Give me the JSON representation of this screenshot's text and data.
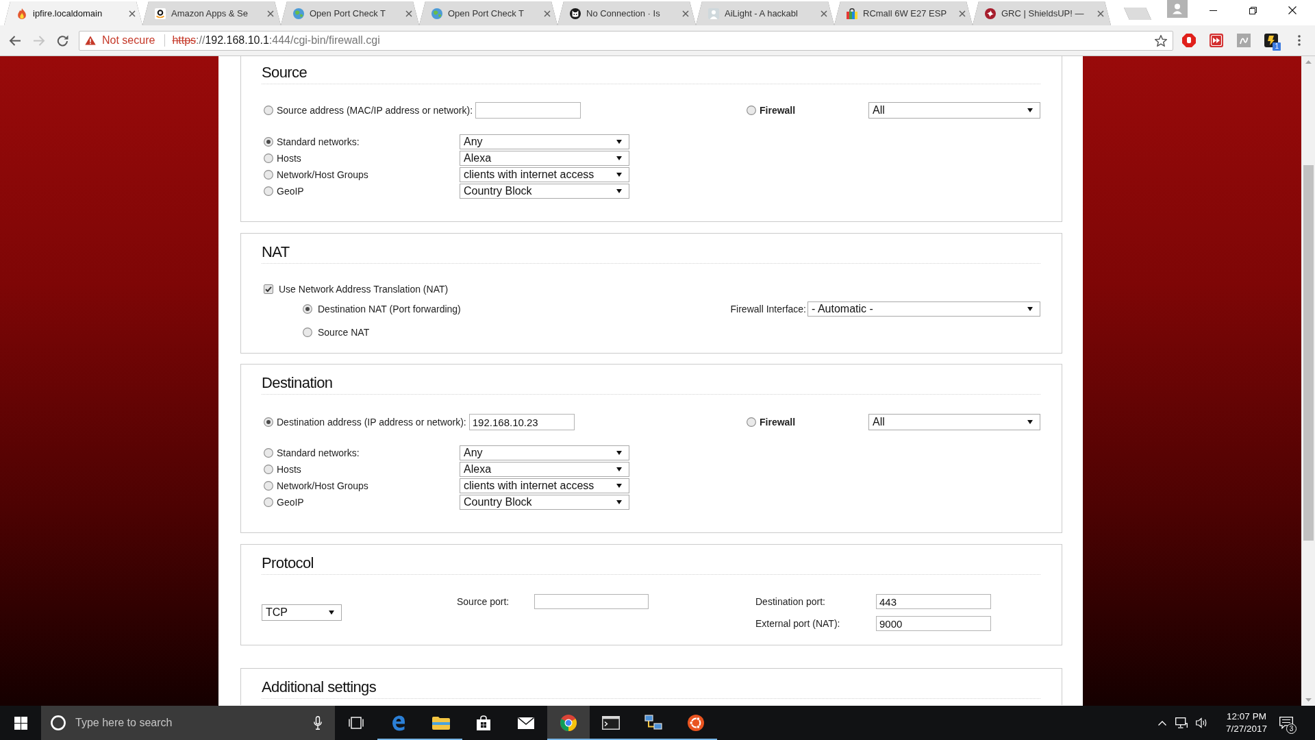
{
  "browser": {
    "tabs": [
      {
        "title": "ipfire.localdomain",
        "selected": true
      },
      {
        "title": "Amazon Apps & Se",
        "selected": false
      },
      {
        "title": "Open Port Check T",
        "selected": false
      },
      {
        "title": "Open Port Check T",
        "selected": false
      },
      {
        "title": "No Connection · Is",
        "selected": false
      },
      {
        "title": "AiLight - A hackabl",
        "selected": false
      },
      {
        "title": "RCmall 6W E27 ESP",
        "selected": false
      },
      {
        "title": "GRC | ShieldsUP! —",
        "selected": false
      }
    ],
    "forward_button": {
      "disabled": true
    },
    "address_bar": {
      "security_label": "Not secure",
      "url": {
        "scheme": "https",
        "separator": "://",
        "host": "192.168.10.1",
        "path": ":444/cgi-bin/firewall.cgi"
      }
    },
    "extension_badge": "1"
  },
  "source": {
    "title": "Source",
    "address": {
      "label": "Source address (MAC/IP address or network):",
      "selected": false
    },
    "firewall": {
      "label": "Firewall",
      "selected": false,
      "value": "All"
    },
    "networks": [
      {
        "label": "Standard networks:",
        "selected": true,
        "value": "Any"
      },
      {
        "label": "Hosts",
        "selected": false,
        "value": "Alexa"
      },
      {
        "label": "Network/Host Groups",
        "selected": false,
        "value": "clients with internet access"
      },
      {
        "label": "GeoIP",
        "selected": false,
        "value": "Country Block"
      }
    ]
  },
  "nat": {
    "title": "NAT",
    "use_nat": {
      "label": "Use Network Address Translation (NAT)",
      "checked": true
    },
    "modes": [
      {
        "label": "Destination NAT (Port forwarding)",
        "selected": true
      },
      {
        "label": "Source NAT",
        "selected": false
      }
    ],
    "firewall_interface": {
      "label": "Firewall Interface:",
      "value": "- Automatic -"
    }
  },
  "destination": {
    "title": "Destination",
    "address": {
      "label": "Destination address (IP address or network):",
      "selected": true,
      "value": "192.168.10.23"
    },
    "firewall": {
      "label": "Firewall",
      "selected": false,
      "value": "All"
    },
    "networks": [
      {
        "label": "Standard networks:",
        "selected": false,
        "value": "Any"
      },
      {
        "label": "Hosts",
        "selected": false,
        "value": "Alexa"
      },
      {
        "label": "Network/Host Groups",
        "selected": false,
        "value": "clients with internet access"
      },
      {
        "label": "GeoIP",
        "selected": false,
        "value": "Country Block"
      }
    ]
  },
  "protocol": {
    "title": "Protocol",
    "value": "TCP",
    "source_port": {
      "label": "Source port:"
    },
    "destination_port": {
      "label": "Destination port:",
      "value": "443"
    },
    "external_port": {
      "label": "External port (NAT):",
      "value": "9000"
    }
  },
  "additional_settings": {
    "title": "Additional settings"
  },
  "taskbar": {
    "search": {
      "placeholder": "Type here to search"
    },
    "apps": [
      {
        "running": true,
        "selected": false
      },
      {
        "running": true,
        "selected": false
      },
      {
        "running": false,
        "selected": false
      },
      {
        "running": false,
        "selected": false
      },
      {
        "running": true,
        "selected": true
      },
      {
        "running": true,
        "selected": false
      },
      {
        "running": true,
        "selected": false
      },
      {
        "running": true,
        "selected": false
      }
    ],
    "clock": {
      "time": "12:07 PM",
      "date": "7/27/2017"
    },
    "notification_count": "3"
  }
}
